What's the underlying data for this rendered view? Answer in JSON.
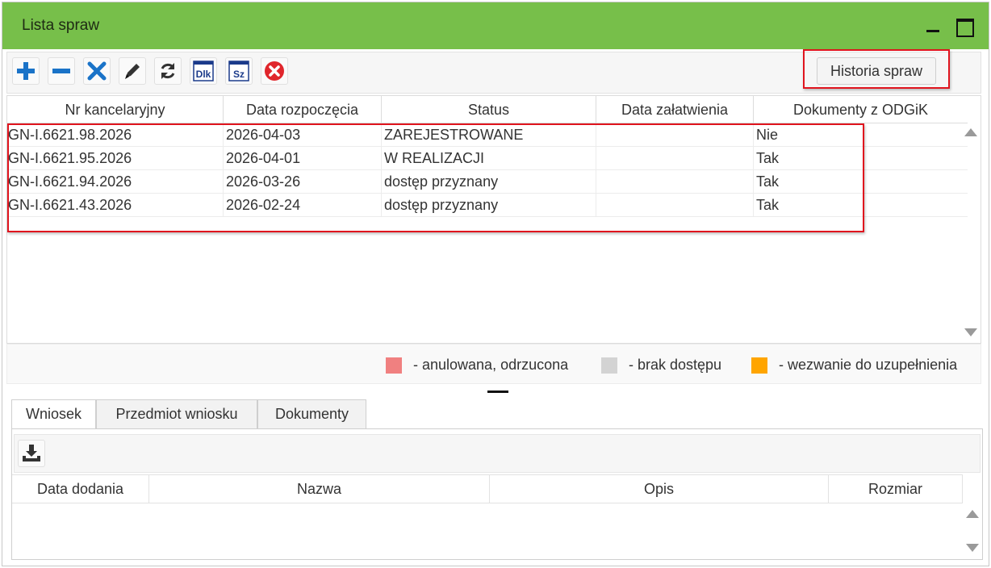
{
  "window": {
    "title": "Lista spraw",
    "accent_color": "#77bf4a",
    "minimize_icon": "minimize-icon",
    "maximize_icon": "maximize-icon"
  },
  "toolbar": {
    "buttons": [
      {
        "name": "add",
        "icon": "plus-icon"
      },
      {
        "name": "remove",
        "icon": "minus-icon"
      },
      {
        "name": "delete",
        "icon": "x-icon"
      },
      {
        "name": "edit",
        "icon": "pencil-icon"
      },
      {
        "name": "refresh",
        "icon": "refresh-icon"
      },
      {
        "name": "dlk",
        "icon": "dlk-icon",
        "label": "Dlk"
      },
      {
        "name": "sz",
        "icon": "sz-icon",
        "label": "Sz"
      },
      {
        "name": "cancel",
        "icon": "cancel-circle-icon"
      }
    ],
    "history_button": "Historia spraw"
  },
  "cases_table": {
    "columns": [
      "Nr kancelaryjny",
      "Data rozpoczęcia",
      "Status",
      "Data załatwienia",
      "Dokumenty z ODGiK"
    ],
    "rows": [
      {
        "nr": "GN-I.6621.98.2026",
        "data_rozp": "2026-04-03",
        "status": "ZAREJESTROWANE",
        "data_zal": "",
        "dok": "Nie"
      },
      {
        "nr": "GN-I.6621.95.2026",
        "data_rozp": "2026-04-01",
        "status": "W REALIZACJI",
        "data_zal": "",
        "dok": "Tak"
      },
      {
        "nr": "GN-I.6621.94.2026",
        "data_rozp": "2026-03-26",
        "status": "dostęp przyznany",
        "data_zal": "",
        "dok": "Tak"
      },
      {
        "nr": "GN-I.6621.43.2026",
        "data_rozp": "2026-02-24",
        "status": "dostęp przyznany",
        "data_zal": "",
        "dok": "Tak"
      }
    ]
  },
  "legend": [
    {
      "label": "- anulowana, odrzucona",
      "color": "#f08080"
    },
    {
      "label": "- brak dostępu",
      "color": "#d3d3d3"
    },
    {
      "label": "- wezwanie do uzupełnienia",
      "color": "#ffa500"
    }
  ],
  "tabs": [
    "Wniosek",
    "Przedmiot wniosku",
    "Dokumenty"
  ],
  "documents_table": {
    "download_icon": "download-icon",
    "columns": [
      "Data dodania",
      "Nazwa",
      "Opis",
      "Rozmiar"
    ]
  }
}
